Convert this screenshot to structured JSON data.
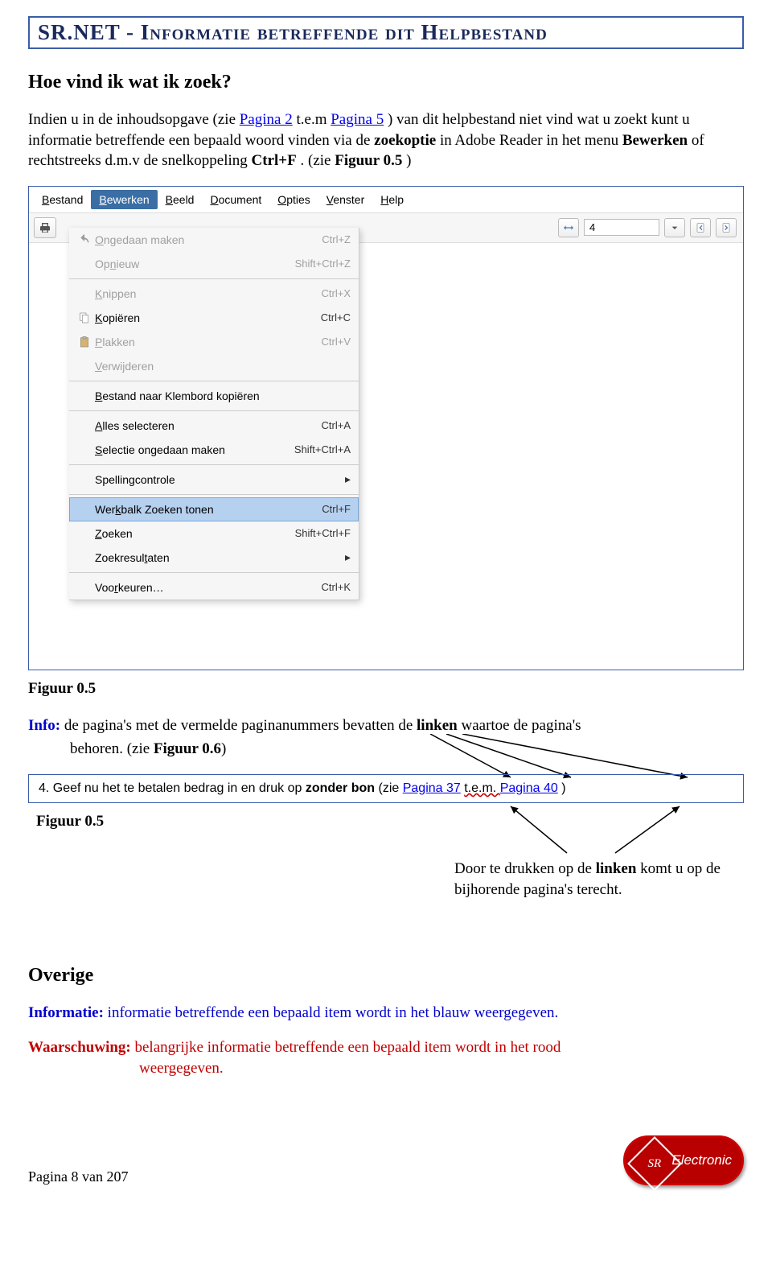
{
  "title": "SR.NET - Informatie betreffende dit Helpbestand",
  "section_heading": "Hoe vind ik wat ik zoek?",
  "intro": {
    "part1": "Indien u in de inhoudsopgave (zie ",
    "link1": "Pagina 2",
    "part2": " t.e.m ",
    "link2": "Pagina 5",
    "part3": ") van dit helpbestand niet vind wat u zoekt kunt u informatie betreffende een bepaald woord vinden via de ",
    "bold1": "zoekoptie",
    "part4": " in Adobe Reader in het menu ",
    "bold2": "Bewerken",
    "part5": " of rechtstreeks d.m.v de snelkoppeling ",
    "bold3": "Ctrl+F",
    "part6": ". (zie ",
    "bold4": "Figuur 0.5",
    "part7": ")"
  },
  "figure1": {
    "menubar": [
      "Bestand",
      "Bewerken",
      "Beeld",
      "Document",
      "Opties",
      "Venster",
      "Help"
    ],
    "active_menu_index": 1,
    "page_value": "4",
    "dropdown": [
      {
        "label": "Ongedaan maken",
        "shortcut": "Ctrl+Z",
        "disabled": true,
        "icon": "undo",
        "ul": "O"
      },
      {
        "label": "Opnieuw",
        "shortcut": "Shift+Ctrl+Z",
        "disabled": true,
        "ul": "n"
      },
      "---",
      {
        "label": "Knippen",
        "shortcut": "Ctrl+X",
        "disabled": true,
        "ul": "K"
      },
      {
        "label": "Kopiëren",
        "shortcut": "Ctrl+C",
        "disabled": false,
        "icon": "copy",
        "ul": "K"
      },
      {
        "label": "Plakken",
        "shortcut": "Ctrl+V",
        "disabled": true,
        "icon": "paste",
        "ul": "P"
      },
      {
        "label": "Verwijderen",
        "shortcut": "",
        "disabled": true,
        "ul": "V"
      },
      "---",
      {
        "label": "Bestand naar Klembord kopiëren",
        "shortcut": "",
        "disabled": false,
        "ul": "B"
      },
      "---",
      {
        "label": "Alles selecteren",
        "shortcut": "Ctrl+A",
        "disabled": false,
        "ul": "A"
      },
      {
        "label": "Selectie ongedaan maken",
        "shortcut": "Shift+Ctrl+A",
        "disabled": false,
        "ul": "S"
      },
      "---",
      {
        "label": "Spellingcontrole",
        "shortcut": "",
        "disabled": false,
        "submenu": true,
        "ul": "g"
      },
      "---",
      {
        "label": "Werkbalk Zoeken tonen",
        "shortcut": "Ctrl+F",
        "disabled": false,
        "highlight": true,
        "ul": "k"
      },
      {
        "label": "Zoeken",
        "shortcut": "Shift+Ctrl+F",
        "disabled": false,
        "ul": "Z"
      },
      {
        "label": "Zoekresultaten",
        "shortcut": "",
        "disabled": false,
        "submenu": true,
        "ul": "t"
      },
      "---",
      {
        "label": "Voorkeuren…",
        "shortcut": "Ctrl+K",
        "disabled": false,
        "ul": "r"
      }
    ]
  },
  "caption1": "Figuur 0.5",
  "info_block": {
    "label": "Info:",
    "line1": " de pagina's met de vermelde paginanummers bevatten de ",
    "bold1": "linken",
    "line2": " waartoe de pagina's",
    "line3": "behoren. (zie ",
    "bold2": "Figuur 0.6",
    "line4": ")"
  },
  "figure2": {
    "num": "4.",
    "text1": " Geef nu het te betalen bedrag in en druk op ",
    "bold1": "zonder bon",
    "text2": " (zie ",
    "link1": "Pagina 37",
    "wavy": " t.e.m. ",
    "link2": "Pagina 40",
    "text3": ")"
  },
  "caption2": "Figuur 0.5",
  "link_note": {
    "text1": "Door te drukken op de ",
    "bold": "linken",
    "text2": " komt u op de bijhorende pagina's terecht."
  },
  "overige_heading": "Overige",
  "informatie": {
    "label": "Informatie:",
    "text": " informatie betreffende een bepaald item wordt in het blauw weergegeven."
  },
  "waarschuwing": {
    "label": "Waarschuwing:",
    "text1": " belangrijke informatie betreffende een bepaald item wordt in het rood",
    "text2": "weergegeven."
  },
  "footer": {
    "page": "Pagina 8 van 207",
    "logo_monogram": "SR",
    "logo_text": "Electronic"
  }
}
